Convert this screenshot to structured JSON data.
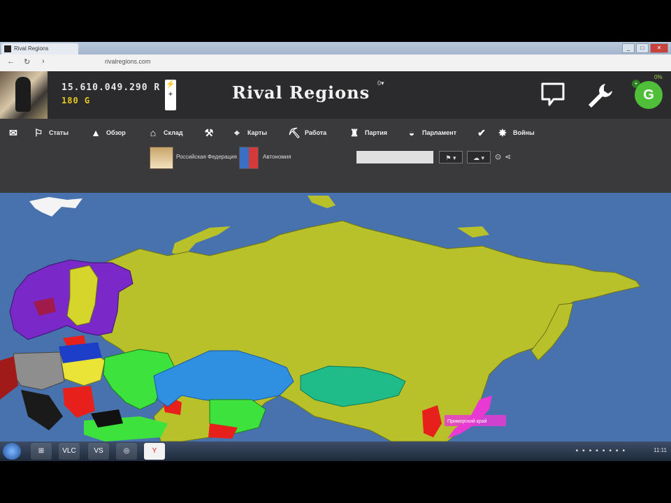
{
  "browser": {
    "tab_title": "Rival Regions",
    "url": "rivalregions.com",
    "window_controls": [
      "_",
      "□",
      "✕"
    ]
  },
  "header": {
    "money": "15.610.049.290 R",
    "gold": "180 G",
    "energy_label": "+",
    "title": "Rival Regions",
    "title_badge": "0▾",
    "level_letter": "G",
    "level_percent": "0%",
    "level_small": "+"
  },
  "nav": {
    "items": [
      {
        "icon": "mail-icon",
        "label": ""
      },
      {
        "icon": "stats-icon",
        "label": "Статы"
      },
      {
        "icon": "food-icon",
        "label": "Обзор"
      },
      {
        "icon": "storage-icon",
        "label": "Склад"
      },
      {
        "icon": "auction-icon",
        "label": ""
      },
      {
        "icon": "map-pin-icon",
        "label": "Карты"
      },
      {
        "icon": "pickaxe-icon",
        "label": "Работа"
      },
      {
        "icon": "party-icon",
        "label": "Партия"
      },
      {
        "icon": "parliament-icon",
        "label": "Парламент"
      },
      {
        "icon": "check-icon",
        "label": ""
      },
      {
        "icon": "war-icon",
        "label": "Войны"
      }
    ]
  },
  "subbar": {
    "state1_label": "Российская Федерация",
    "state2_label": "Автономия",
    "search_value": "",
    "select1": "⚑ ▾",
    "select2": "☁ ▾"
  },
  "map": {
    "region_label": "Приморский край",
    "colors": {
      "ocean": "#4872ad",
      "russia": "#b8c02a",
      "kazakhstan": "#2f8fe0",
      "mongolia": "#1fbb88",
      "ukraine": "#3de23d",
      "sweden": "#7a28c8",
      "finland": "#d6d52c",
      "poland": "#eae437",
      "germany": "#8e8e8e",
      "red_region": "#e8201c",
      "magenta_region": "#e83ad2"
    }
  },
  "taskbar": {
    "apps": [
      "⊞",
      "VLC",
      "VS",
      "◎",
      "Y"
    ],
    "clock": "11:11"
  }
}
